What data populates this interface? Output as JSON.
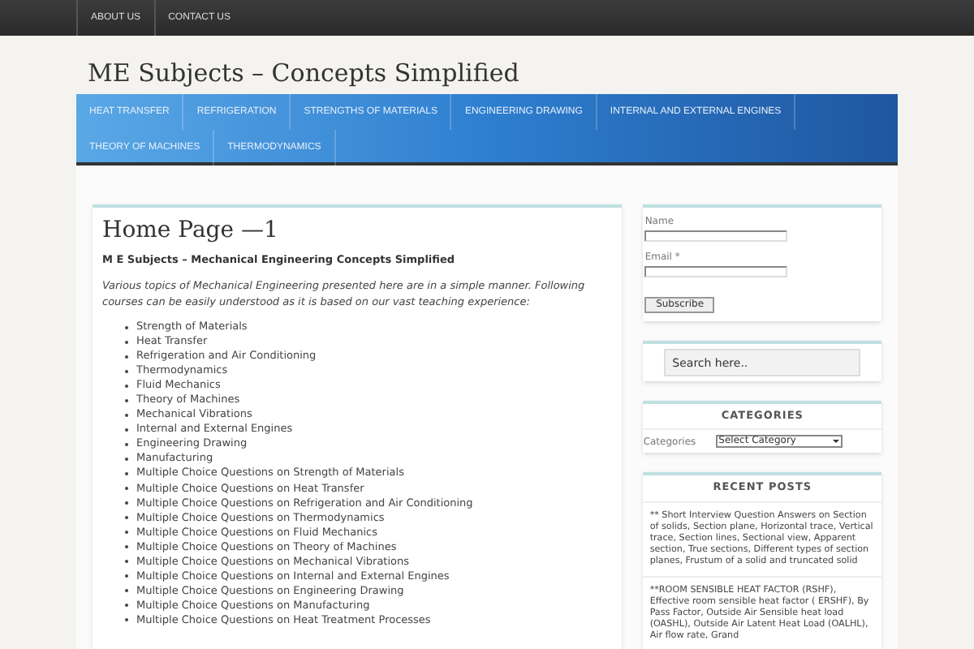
{
  "top_menu": [
    {
      "label": "ABOUT US"
    },
    {
      "label": "CONTACT US"
    }
  ],
  "site_title": "ME Subjects – Concepts Simplified",
  "nav": [
    {
      "label": "HEAT TRANSFER"
    },
    {
      "label": "REFRIGERATION"
    },
    {
      "label": "STRENGTHS OF MATERIALS"
    },
    {
      "label": "ENGINEERING DRAWING"
    },
    {
      "label": "INTERNAL AND EXTERNAL ENGINES"
    },
    {
      "label": "THEORY OF MACHINES"
    },
    {
      "label": "THERMODYNAMICS"
    }
  ],
  "article": {
    "title": "Home Page —1",
    "subtitle": "M E Subjects – Mechanical Engineering Concepts Simplified",
    "intro": "Various topics of Mechanical Engineering presented here are in a simple manner. Following courses can be easily understood as it is based on our vast teaching experience:",
    "items": [
      "Strength of Materials",
      "Heat Transfer",
      "Refrigeration and Air Conditioning",
      "Thermodynamics",
      "Fluid Mechanics",
      "Theory of Machines",
      "Mechanical Vibrations",
      "Internal and External Engines",
      "Engineering Drawing",
      "Manufacturing",
      "Multiple Choice Questions on Strength of Materials",
      "Multiple Choice Questions on Heat Transfer",
      "Multiple Choice Questions on Refrigeration and Air Conditioning",
      "Multiple Choice Questions on Thermodynamics",
      "Multiple Choice Questions on Fluid Mechanics",
      "Multiple Choice Questions on Theory of Machines",
      "Multiple Choice Questions on Mechanical Vibrations",
      "Multiple Choice Questions on Internal and External Engines",
      "Multiple Choice Questions on Engineering Drawing",
      "Multiple Choice Questions on Manufacturing",
      "Multiple Choice Questions on Heat Treatment Processes"
    ]
  },
  "subscribe": {
    "name_label": "Name",
    "email_label": "Email *",
    "button": "Subscribe"
  },
  "search": {
    "placeholder": "Search here.."
  },
  "categories": {
    "heading": "CATEGORIES",
    "label": "Categories",
    "select_value": "Select Category"
  },
  "recent_posts": {
    "heading": "RECENT POSTS",
    "posts": [
      "** Short Interview Question Answers on Section of solids, Section plane, Horizontal trace, Vertical trace, Section lines, Sectional view, Apparent section, True sections, Different types of section planes, Frustum of a solid and truncated solid",
      "**ROOM SENSIBLE HEAT FACTOR (RSHF), Effective room sensible heat factor ( ERSHF), By Pass Factor, Outside Air Sensible heat load (OASHL), Outside Air Latent Heat Load (OALHL), Air flow rate, Grand"
    ]
  }
}
